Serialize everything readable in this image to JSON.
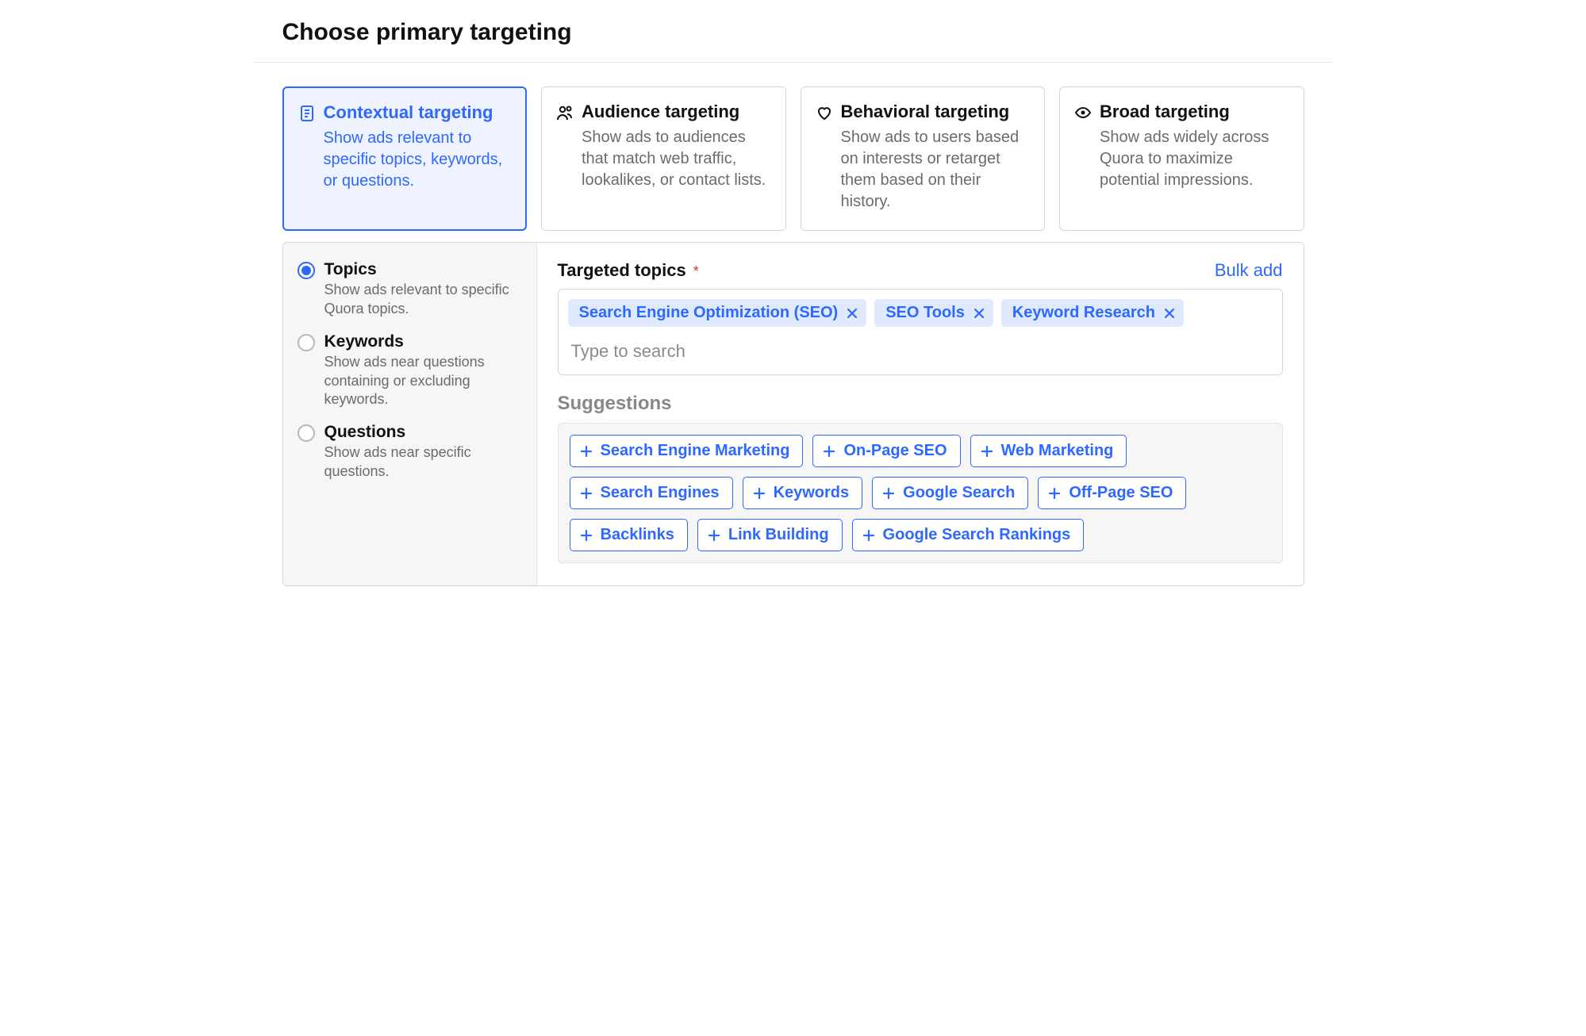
{
  "page_title": "Choose primary targeting",
  "targeting_cards": [
    {
      "id": "contextual",
      "title": "Contextual targeting",
      "description": "Show ads relevant to specific topics, keywords, or questions.",
      "icon": "document-icon",
      "selected": true
    },
    {
      "id": "audience",
      "title": "Audience targeting",
      "description": "Show ads to audiences that match web traffic, lookalikes, or contact lists.",
      "icon": "people-icon",
      "selected": false
    },
    {
      "id": "behavioral",
      "title": "Behavioral targeting",
      "description": "Show ads to users based on interests or retarget them based on their history.",
      "icon": "heart-icon",
      "selected": false
    },
    {
      "id": "broad",
      "title": "Broad targeting",
      "description": "Show ads widely across Quora to maximize potential impressions.",
      "icon": "eye-icon",
      "selected": false
    }
  ],
  "sidebar_options": [
    {
      "id": "topics",
      "label": "Topics",
      "description": "Show ads relevant to specific Quora topics.",
      "selected": true
    },
    {
      "id": "keywords",
      "label": "Keywords",
      "description": "Show ads near questions containing or excluding keywords.",
      "selected": false
    },
    {
      "id": "questions",
      "label": "Questions",
      "description": "Show ads near specific questions.",
      "selected": false
    }
  ],
  "main": {
    "field_label": "Targeted topics",
    "required_marker": "*",
    "bulk_add_label": "Bulk add",
    "search_placeholder": "Type to search",
    "selected_chips": [
      "Search Engine Optimization (SEO)",
      "SEO Tools",
      "Keyword Research"
    ],
    "suggestions_title": "Suggestions",
    "suggestions": [
      "Search Engine Marketing",
      "On-Page SEO",
      "Web Marketing",
      "Search Engines",
      "Keywords",
      "Google Search",
      "Off-Page SEO",
      "Backlinks",
      "Link Building",
      "Google Search Rankings"
    ]
  },
  "colors": {
    "accent": "#2e68ff",
    "chip_bg": "#e0eaff",
    "border": "#d6d6d6",
    "muted_text": "#6b6b6b"
  }
}
